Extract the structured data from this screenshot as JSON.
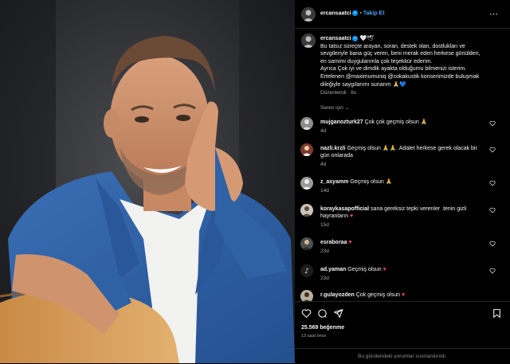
{
  "post": {
    "username": "ercansaatci",
    "follow_label": "Takip Et",
    "more_icon": "more-horizontal-icon",
    "caption_lines": [
      "Bu tatsız süreçte arayan, soran, destek olan, dostlukları ve",
      "sevgileriyle bana güç veren, beni merak eden herkese gönülden,",
      "en samimi duygularımla çok teşekkür ederim.",
      "Ayrıca Çok iyi ve dimdik ayakta olduğumu bilmenizi isterim.",
      "Ertelenen @maximumuniq @cokakustik konserimizde buluşmak",
      "dileğiyle saygılarımı sunarım 🙏💙"
    ],
    "caption_emojis": "🤍🕊",
    "edited_label": "Düzenlendi · 6s",
    "translate_label": "Seren için ⌄",
    "likes": "25.569 beğenme",
    "time_ago": "13 saat önce",
    "footer_notice": "Bu gönderideki yorumlar sınırlandırıldı."
  },
  "comments": [
    {
      "user": "mujganozturk27",
      "text": "Çok çok geçmiş olsun 🙏",
      "time": "4d"
    },
    {
      "user": "nazli.krzli",
      "text": "Geçmiş olsun 🙏🙏. Adalet herkese gerek olacak bir gün onlarada",
      "time": "4d"
    },
    {
      "user": "z_asyamm",
      "text": "Geçmiş olsun 🙏",
      "time": "14d"
    },
    {
      "user": "koraykasapofficial",
      "text": "sana gereksiz tepki verenler .tenin gizli hayranların",
      "time": "15d"
    },
    {
      "user": "esraboraa",
      "text": "",
      "time": "23d"
    },
    {
      "user": "ad.yaman",
      "text": "Geçmiş olsun",
      "time": "23d"
    },
    {
      "user": "r.gulayozden",
      "text": "Çok geçmiş olsun",
      "time": ""
    }
  ],
  "colors": {
    "accent": "#0095f6",
    "heart_red": "#ed4956",
    "jacket_blue": "#2f61a5"
  }
}
